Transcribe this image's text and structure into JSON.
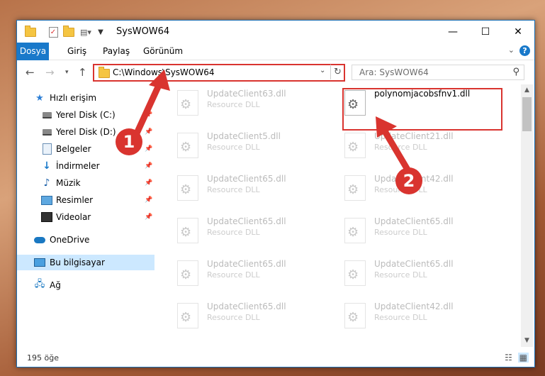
{
  "window": {
    "title": "SysWOW64"
  },
  "ribbon": {
    "tabs": [
      "Dosya",
      "Giriş",
      "Paylaş",
      "Görünüm"
    ],
    "help": "?"
  },
  "controls": {
    "minimize": "—",
    "maximize": "☐",
    "close": "✕"
  },
  "nav": {
    "address": "C:\\Windows\\SysWOW64",
    "search_placeholder": "Ara: SysWOW64"
  },
  "sidebar": {
    "items": [
      {
        "label": "Hızlı erişim",
        "icon": "star-icon"
      },
      {
        "label": "Yerel Disk (C:)",
        "icon": "disk-icon"
      },
      {
        "label": "Yerel Disk (D:)",
        "icon": "disk-icon"
      },
      {
        "label": "Belgeler",
        "icon": "document-icon"
      },
      {
        "label": "İndirmeler",
        "icon": "download-icon"
      },
      {
        "label": "Müzik",
        "icon": "music-icon"
      },
      {
        "label": "Resimler",
        "icon": "pictures-icon"
      },
      {
        "label": "Videolar",
        "icon": "video-icon"
      },
      {
        "label": "OneDrive",
        "icon": "cloud-icon"
      },
      {
        "label": "Bu bilgisayar",
        "icon": "computer-icon"
      },
      {
        "label": "Ağ",
        "icon": "network-icon"
      }
    ]
  },
  "files": {
    "left": [
      {
        "name": "UpdateClient63.dll",
        "type": "Resource DLL"
      },
      {
        "name": "UpdateClient5.dll",
        "type": "Resource DLL"
      },
      {
        "name": "UpdateClient65.dll",
        "type": "Resource DLL"
      },
      {
        "name": "UpdateClient65.dll",
        "type": "Resource DLL"
      },
      {
        "name": "UpdateClient65.dll",
        "type": "Resource DLL"
      },
      {
        "name": "UpdateClient65.dll",
        "type": "Resource DLL"
      }
    ],
    "right": [
      {
        "name": "polynomjacobsfnv1.dll",
        "type": ""
      },
      {
        "name": "UpdateClient21.dll",
        "type": "Resource DLL"
      },
      {
        "name": "UpdateClient42.dll",
        "type": "Resource DLL"
      },
      {
        "name": "UpdateClient65.dll",
        "type": "Resource DLL"
      },
      {
        "name": "UpdateClient65.dll",
        "type": "Resource DLL"
      },
      {
        "name": "UpdateClient42.dll",
        "type": "Resource DLL"
      }
    ]
  },
  "status": {
    "count": "195 öğe"
  },
  "annotations": {
    "step1": "1",
    "step2": "2",
    "color": "#d9342f"
  }
}
